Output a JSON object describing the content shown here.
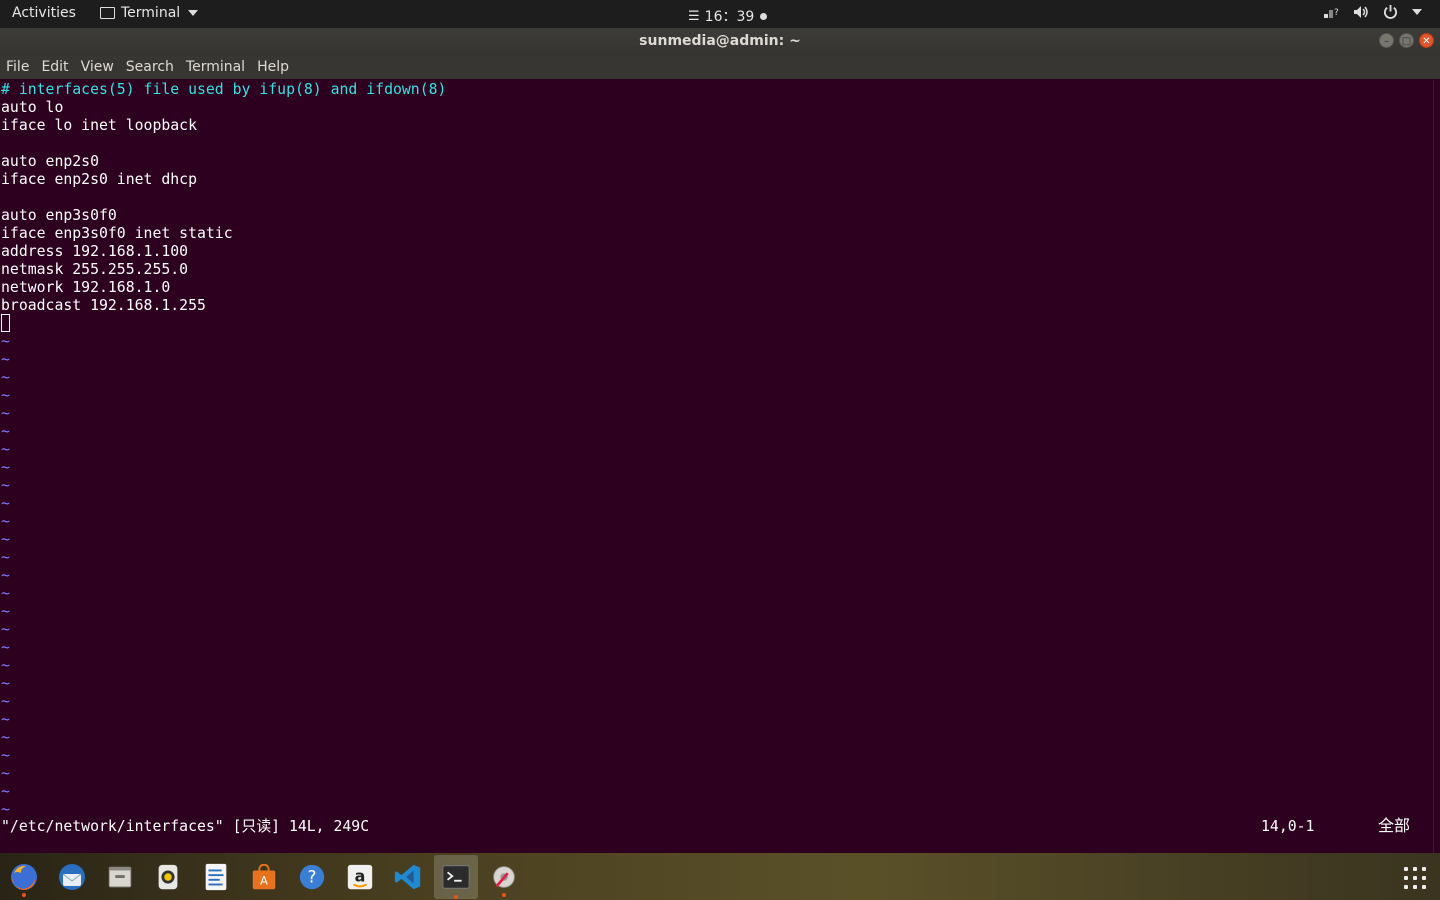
{
  "topbar": {
    "activities": "Activities",
    "app_menu": "Terminal",
    "clock": "16：39",
    "icons": [
      "network-icon",
      "volume-icon",
      "power-icon",
      "chevron-down-icon"
    ]
  },
  "window": {
    "title": "sunmedia@admin: ~"
  },
  "menu": {
    "file": "File",
    "edit": "Edit",
    "view": "View",
    "search": "Search",
    "terminal": "Terminal",
    "help": "Help"
  },
  "editor": {
    "comment": "# interfaces(5) file used by ifup(8) and ifdown(8)",
    "lines": [
      "auto lo",
      "iface lo inet loopback",
      "",
      "auto enp2s0",
      "iface enp2s0 inet dhcp",
      "",
      "auto enp3s0f0",
      "iface enp3s0f0 inet static",
      "address 192.168.1.100",
      "netmask 255.255.255.0",
      "network 192.168.1.0",
      "broadcast 192.168.1.255"
    ],
    "tilde": "~",
    "tilde_count": 27,
    "colors": {
      "background": "#2c001e",
      "comment": "#34e2e2",
      "tilde": "#7f7fff",
      "text": "#ffffff"
    }
  },
  "status": {
    "file_info": "\"/etc/network/interfaces\" [只读] 14L, 249C",
    "position": "14,0-1",
    "scroll": "全部"
  },
  "dock": {
    "apps": [
      "firefox-icon",
      "thunderbird-icon",
      "files-icon",
      "rhythmbox-icon",
      "writer-icon",
      "software-icon",
      "help-icon",
      "amazon-icon",
      "vscode-icon",
      "terminal-icon",
      "settings-icon"
    ],
    "active": "terminal-icon"
  }
}
